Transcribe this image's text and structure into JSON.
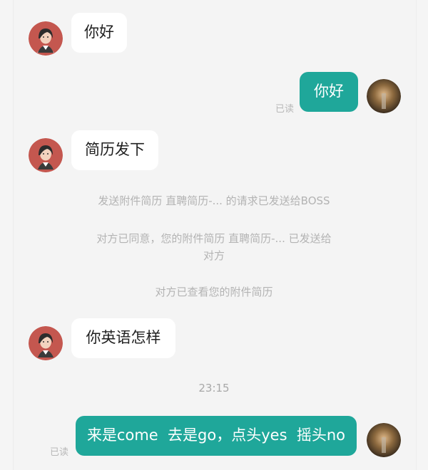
{
  "messages": [
    {
      "side": "in",
      "text": "你好"
    },
    {
      "side": "out",
      "text": "你好",
      "read": "已读"
    },
    {
      "side": "in",
      "text": "简历发下"
    },
    {
      "side": "in",
      "text": "你英语怎样"
    },
    {
      "side": "out",
      "text": "来是come  去是go，点头yes  摇头no",
      "read": "已读"
    }
  ],
  "system": [
    "发送附件简历  直聘简历-... 的请求已发送给BOSS",
    "对方已同意，您的附件简历  直聘简历-... 已发送给",
    "对方",
    "对方已查看您的附件简历"
  ],
  "timestamp": "23:15",
  "colors": {
    "outgoing": "#1fa79a",
    "incoming": "#ffffff",
    "background": "#f4f4f4"
  }
}
